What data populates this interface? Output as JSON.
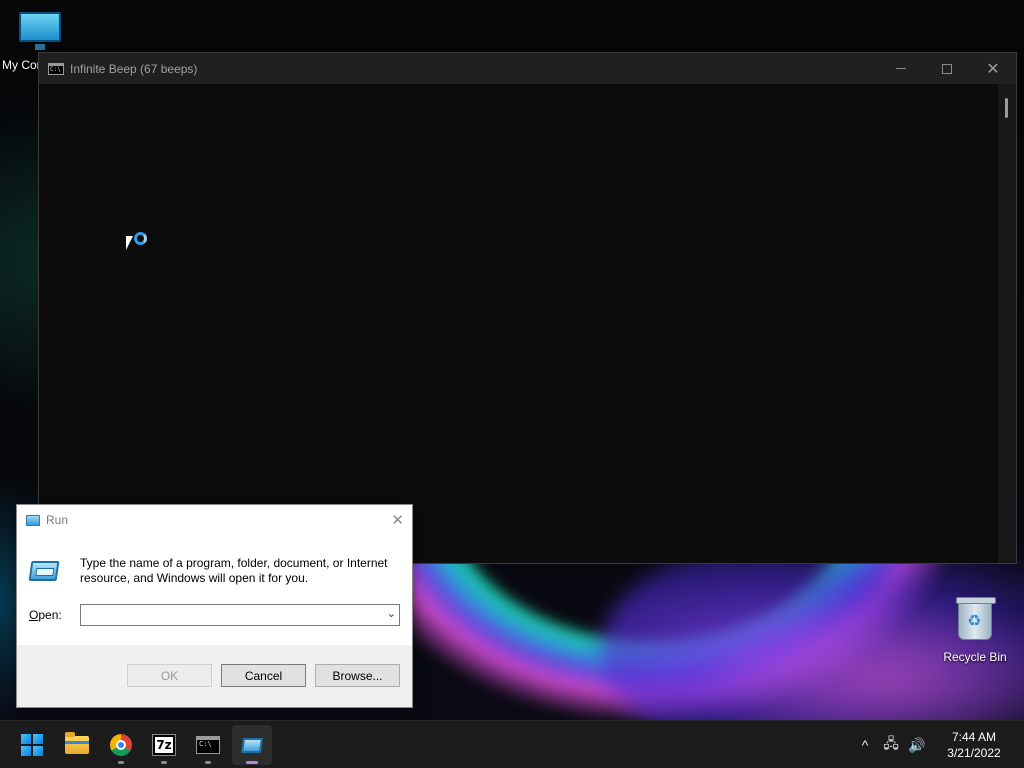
{
  "desktop": {
    "icons": [
      {
        "label": "My Computer"
      },
      {
        "label": "Recycle Bin"
      }
    ]
  },
  "console_window": {
    "title": "Infinite Beep (67 beeps)",
    "icon_glyph": "C:\\",
    "minimize_glyph": "—",
    "maximize_glyph": "☐",
    "close_glyph": "✕"
  },
  "run_dialog": {
    "title": "Run",
    "close_glyph": "✕",
    "description": "Type the name of a program, folder, document, or Internet resource, and Windows will open it for you.",
    "open_label_accel": "O",
    "open_label_rest": "pen:",
    "open_value": "",
    "buttons": {
      "ok": "OK",
      "cancel": "Cancel",
      "browse": "Browse..."
    }
  },
  "taskbar": {
    "items": [
      {
        "name": "start",
        "icon": "windows-logo-icon"
      },
      {
        "name": "file-explorer",
        "icon": "folder-icon"
      },
      {
        "name": "chrome",
        "icon": "chrome-icon"
      },
      {
        "name": "7zip",
        "icon": "7zip-icon",
        "glyph": "7z"
      },
      {
        "name": "terminal",
        "icon": "terminal-icon",
        "glyph": "C:\\"
      },
      {
        "name": "run",
        "icon": "run-icon"
      }
    ],
    "tray": {
      "chevron": "^",
      "network": "🖧",
      "volume": "🔊"
    },
    "clock": {
      "time": "7:44 AM",
      "date": "3/21/2022"
    }
  }
}
